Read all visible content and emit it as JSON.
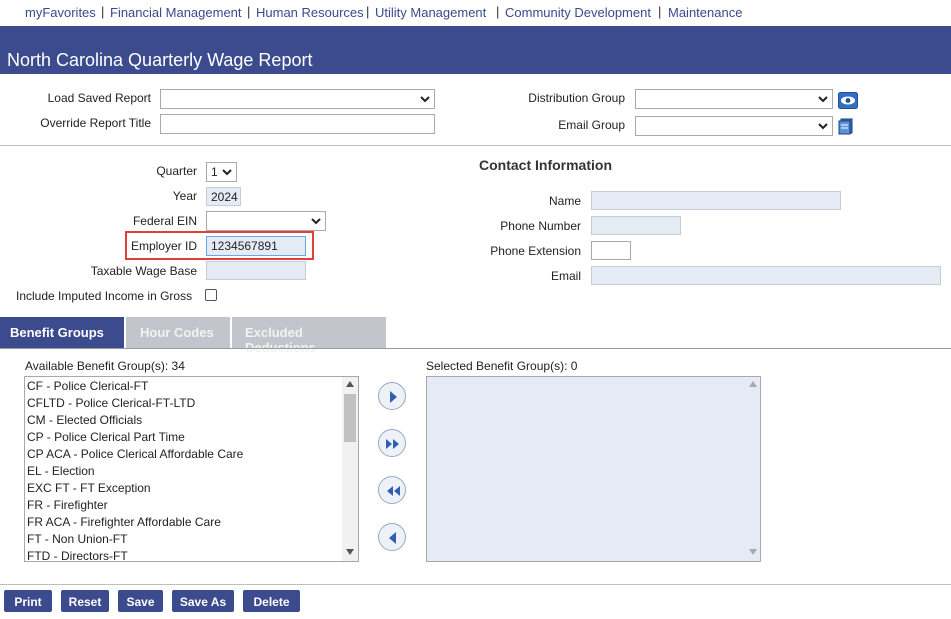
{
  "nav": {
    "items": [
      "myFavorites",
      "Financial Management",
      "Human Resources",
      "Utility Management",
      "Community Development",
      "Maintenance"
    ],
    "separator": "|"
  },
  "page": {
    "title": "North Carolina Quarterly Wage Report"
  },
  "report": {
    "load_saved_label": "Load Saved Report",
    "load_saved_value": "",
    "override_title_label": "Override Report Title",
    "override_title_value": "",
    "distribution_group_label": "Distribution Group",
    "distribution_group_value": "",
    "email_group_label": "Email Group",
    "email_group_value": ""
  },
  "params": {
    "quarter_label": "Quarter",
    "quarter_value": "1",
    "year_label": "Year",
    "year_value": "2024",
    "federal_ein_label": "Federal EIN",
    "federal_ein_value": "",
    "employer_id_label": "Employer ID",
    "employer_id_value": "1234567891",
    "taxable_wage_base_label": "Taxable Wage Base",
    "taxable_wage_base_value": "",
    "imputed_income_label": "Include Imputed Income in Gross",
    "imputed_income_checked": false
  },
  "contact": {
    "title": "Contact Information",
    "name_label": "Name",
    "phone_label": "Phone Number",
    "extension_label": "Phone Extension",
    "email_label": "Email"
  },
  "tabs": [
    "Benefit Groups",
    "Hour Codes",
    "Excluded Deductions"
  ],
  "benefit_groups": {
    "available_label": "Available Benefit Group(s): 34",
    "selected_label": "Selected Benefit Group(s): 0",
    "available": [
      "CF - Police Clerical-FT",
      "CFLTD - Police Clerical-FT-LTD",
      "CM - Elected Officials",
      "CP - Police Clerical Part Time",
      "CP ACA - Police Clerical Affordable Care",
      "EL - Election",
      "EXC FT - FT Exception",
      "FR - Firefighter",
      "FR ACA - Firefighter Affordable Care",
      "FT - Non Union-FT",
      "FTD - Directors-FT"
    ]
  },
  "buttons": [
    "Print",
    "Reset",
    "Save",
    "Save As",
    "Delete"
  ],
  "colors": {
    "brand": "#3b4b8e",
    "highlight": "#e0403a",
    "readonly_field": "#e4ebf5"
  }
}
